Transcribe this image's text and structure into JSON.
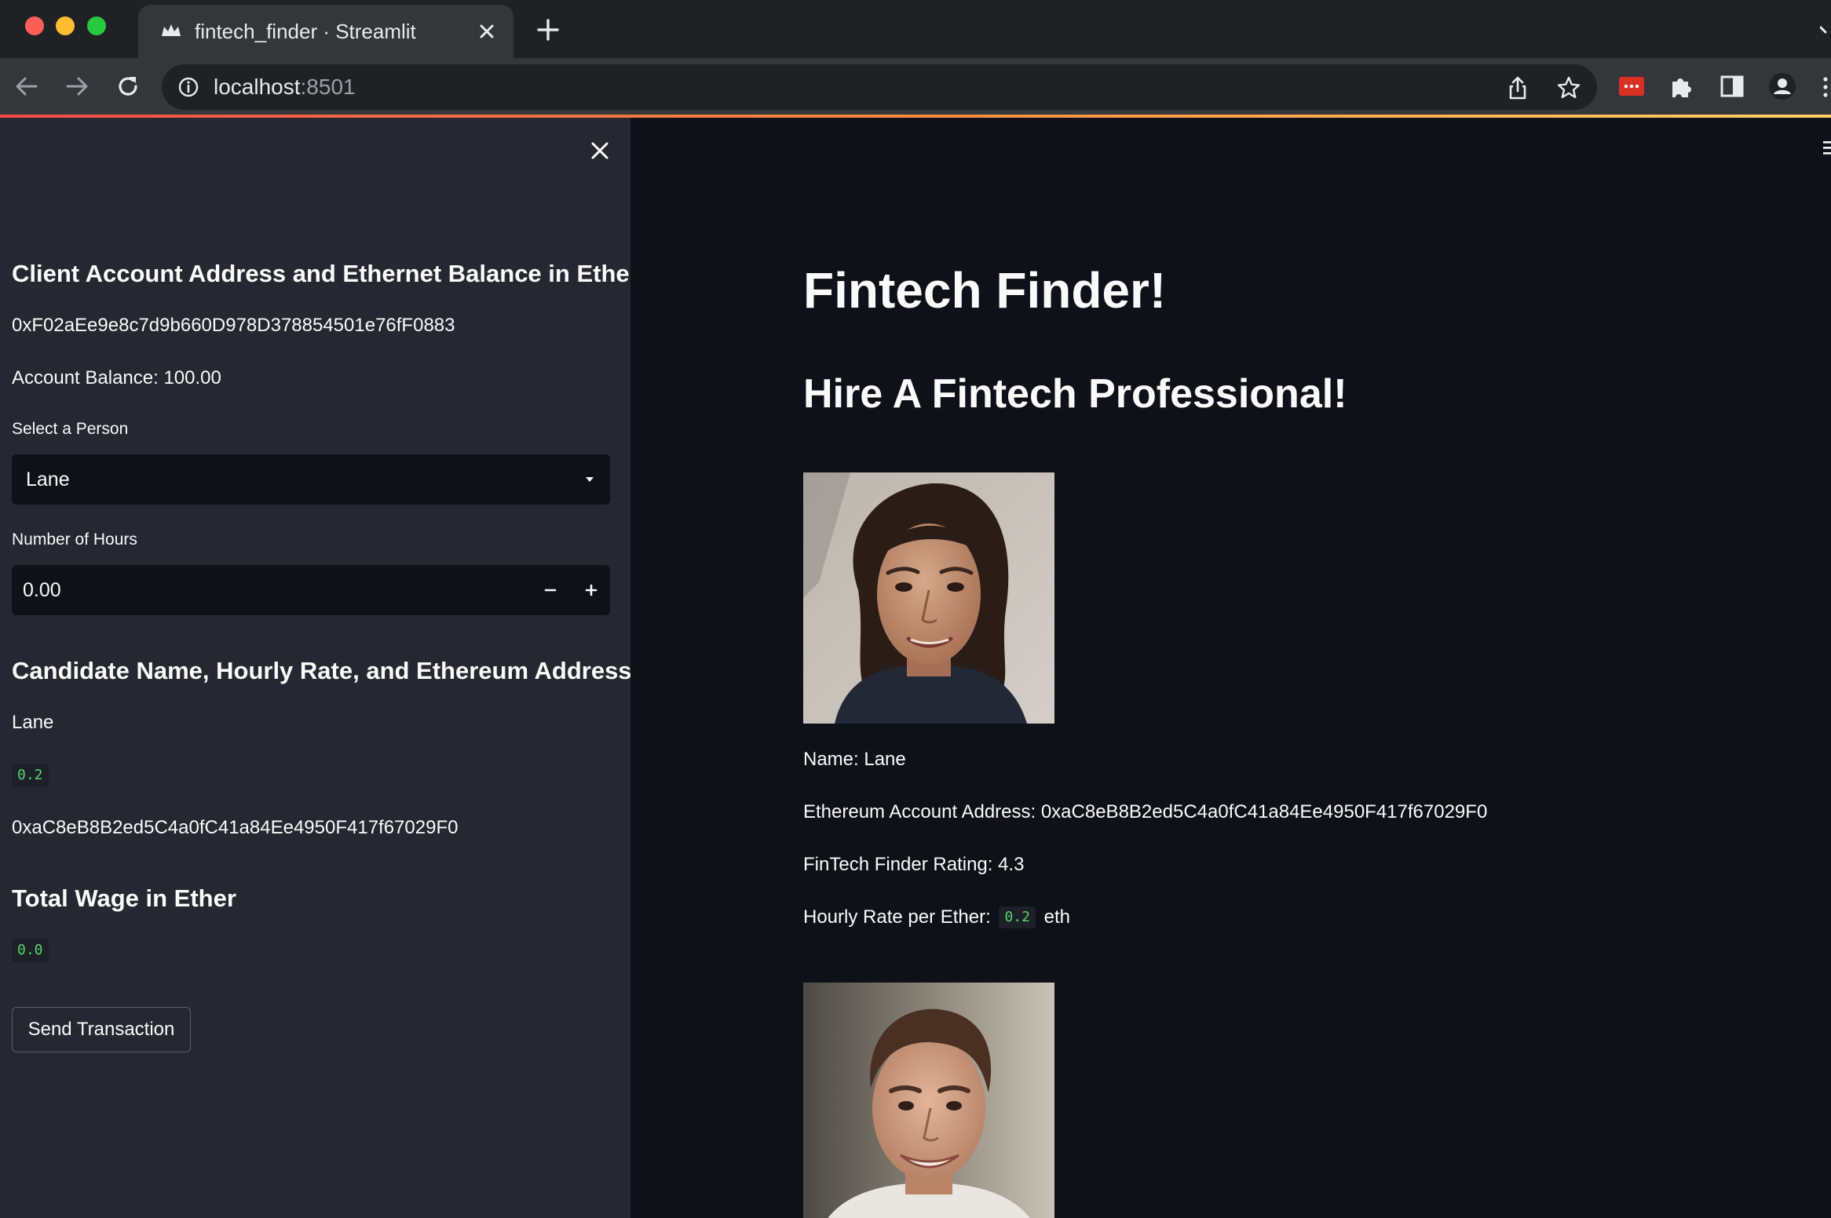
{
  "browser": {
    "tab_title": "fintech_finder · Streamlit",
    "url_host": "localhost",
    "url_port": ":8501"
  },
  "sidebar": {
    "client_heading": "Client Account Address and Ethernet Balance in Ether",
    "client_address": "0xF02aEe9e8c7d9b660D978D378854501e76fF0883",
    "account_balance": "Account Balance: 100.00",
    "select_label": "Select a Person",
    "select_value": "Lane",
    "hours_label": "Number of Hours",
    "hours_value": "0.00",
    "candidate_heading": "Candidate Name, Hourly Rate, and Ethereum Address",
    "candidate_name": "Lane",
    "candidate_rate": "0.2",
    "candidate_address": "0xaC8eB8B2ed5C4a0fC41a84Ee4950F417f67029F0",
    "wage_heading": "Total Wage in Ether",
    "wage_value": "0.0",
    "send_button": "Send Transaction"
  },
  "main": {
    "title": "Fintech Finder!",
    "subtitle": "Hire A Fintech Professional!",
    "candidate": {
      "name_line": "Name: Lane",
      "address_line": "Ethereum Account Address: 0xaC8eB8B2ed5C4a0fC41a84Ee4950F417f67029F0",
      "rating_line": "FinTech Finder Rating: 4.3",
      "rate_prefix": "Hourly Rate per Ether:",
      "rate_value": "0.2",
      "rate_suffix": "eth"
    }
  },
  "colors": {
    "app_background": "#0e1117",
    "sidebar_background": "#262730",
    "code_text": "#5ad36a",
    "accent": "#ff4b4b"
  },
  "icons": [
    "streamlit-crown-icon",
    "close-icon",
    "plus-icon",
    "back-arrow-icon",
    "forward-arrow-icon",
    "reload-icon",
    "info-icon",
    "share-icon",
    "star-icon",
    "extension-red-icon",
    "puzzle-icon",
    "side-panel-icon",
    "profile-icon",
    "kebab-menu-icon",
    "chevron-down-icon",
    "minus-icon"
  ]
}
